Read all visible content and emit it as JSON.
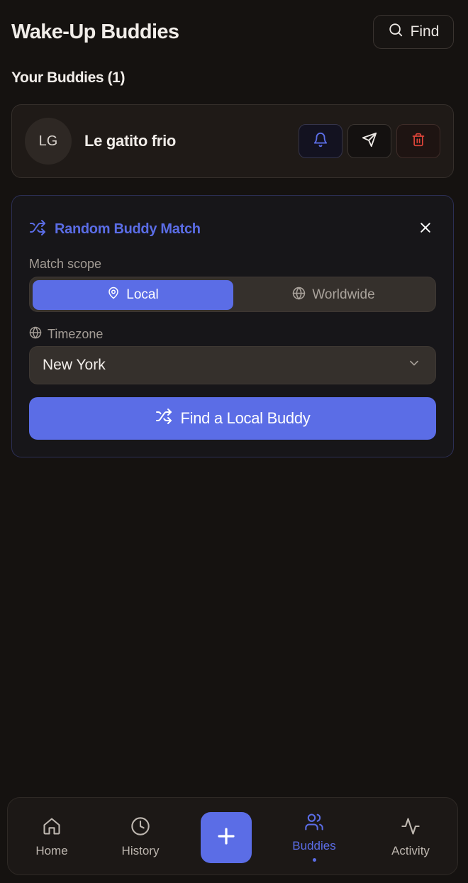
{
  "header": {
    "title": "Wake-Up Buddies",
    "find_label": "Find"
  },
  "buddies": {
    "section_title": "Your Buddies (1)",
    "items": [
      {
        "initials": "LG",
        "name": "Le gatito frio"
      }
    ]
  },
  "match": {
    "title": "Random Buddy Match",
    "scope_label": "Match scope",
    "scope_options": {
      "local": "Local",
      "worldwide": "Worldwide"
    },
    "selected_scope": "Local",
    "timezone_label": "Timezone",
    "timezone_value": "New York",
    "action_label": "Find a Local Buddy"
  },
  "nav": {
    "home": "Home",
    "history": "History",
    "buddies": "Buddies",
    "activity": "Activity",
    "active": "Buddies"
  },
  "colors": {
    "accent": "#5b6de6",
    "background": "#151210",
    "danger": "#e0453a"
  }
}
